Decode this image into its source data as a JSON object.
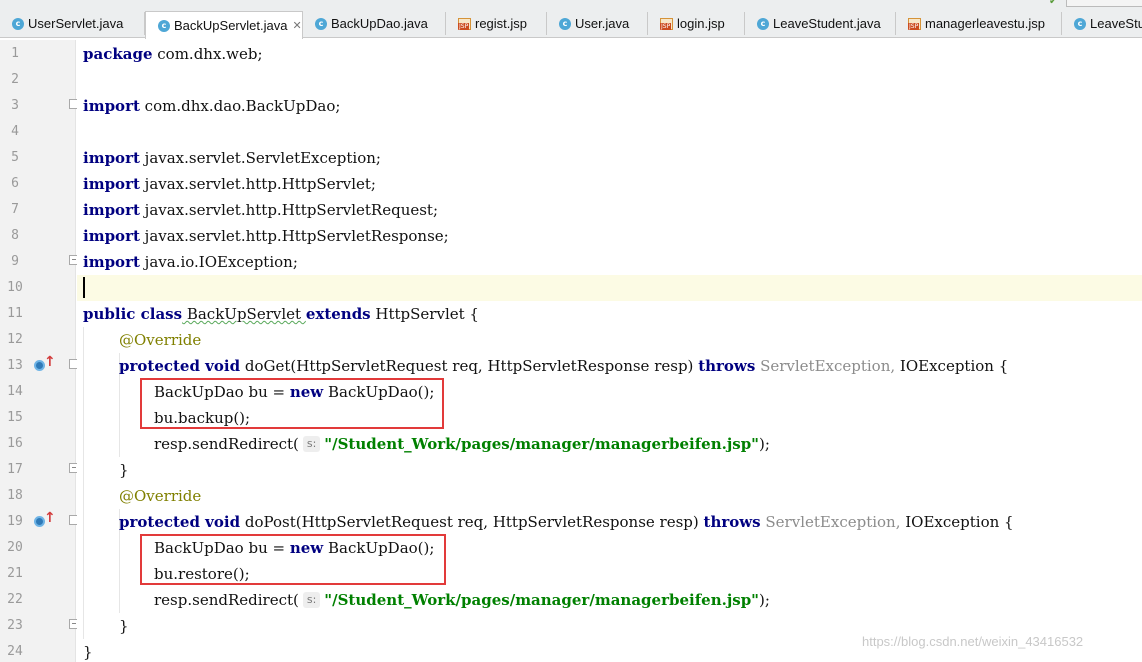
{
  "tabs": [
    {
      "name": "UserServlet.java",
      "type": "java",
      "active": false
    },
    {
      "name": "BackUpServlet.java",
      "type": "java",
      "active": true
    },
    {
      "name": "BackUpDao.java",
      "type": "java",
      "active": false
    },
    {
      "name": "regist.jsp",
      "type": "jsp",
      "active": false
    },
    {
      "name": "User.java",
      "type": "java",
      "active": false
    },
    {
      "name": "login.jsp",
      "type": "jsp",
      "active": false
    },
    {
      "name": "LeaveStudent.java",
      "type": "java",
      "active": false
    },
    {
      "name": "managerleavestu.jsp",
      "type": "jsp",
      "active": false
    },
    {
      "name": "LeaveStud",
      "type": "java",
      "active": false
    }
  ],
  "icons": {
    "java_file": "java-class-icon",
    "jsp_file": "jsp-file-icon",
    "close": "close-icon",
    "override": "override-method-icon"
  },
  "icon_glyphs": {
    "java": "c",
    "jsp": "JSP",
    "close": "✕",
    "arrow": "↑"
  },
  "line_numbers": [
    "1",
    "2",
    "3",
    "4",
    "5",
    "6",
    "7",
    "8",
    "9",
    "10",
    "11",
    "12",
    "13",
    "14",
    "15",
    "16",
    "17",
    "18",
    "19",
    "20",
    "21",
    "22",
    "23",
    "24"
  ],
  "code": {
    "l1": {
      "kw": "package",
      "rest": " com.dhx.web;"
    },
    "l3": {
      "kw": "import",
      "rest": " com.dhx.dao.BackUpDao;"
    },
    "l5": {
      "kw": "import",
      "rest": " javax.servlet.ServletException;"
    },
    "l6": {
      "kw": "import",
      "rest": " javax.servlet.http.HttpServlet;"
    },
    "l7": {
      "kw": "import",
      "rest": " javax.servlet.http.HttpServletRequest;"
    },
    "l8": {
      "kw": "import",
      "rest": " javax.servlet.http.HttpServletResponse;"
    },
    "l9": {
      "kw": "import",
      "rest": " java.io.IOException;"
    },
    "l11": {
      "kw1": "public class",
      "name": " BackUpServlet ",
      "kw2": "extends",
      "rest": " HttpServlet {"
    },
    "l12": {
      "ann": "@Override"
    },
    "l13": {
      "kw1": "protected void",
      "sig": " doGet(HttpServletRequest req, HttpServletResponse resp) ",
      "kw2": "throws",
      "exc1": " ServletException,",
      "exc2": " IOException {"
    },
    "l14": {
      "a": "BackUpDao bu = ",
      "kw": "new",
      "b": " BackUpDao();"
    },
    "l15": {
      "a": "bu.backup();"
    },
    "l16": {
      "a": "resp.sendRedirect(",
      "hint": "s:",
      "str": "\"/Student_Work/pages/manager/managerbeifen.jsp\"",
      "b": ");"
    },
    "l17": {
      "a": "}"
    },
    "l18": {
      "ann": "@Override"
    },
    "l19": {
      "kw1": "protected void",
      "sig": " doPost(HttpServletRequest req, HttpServletResponse resp) ",
      "kw2": "throws",
      "exc1": " ServletException,",
      "exc2": " IOException {"
    },
    "l20": {
      "a": "BackUpDao bu = ",
      "kw": "new",
      "b": " BackUpDao();"
    },
    "l21": {
      "a": "bu.restore();"
    },
    "l22": {
      "a": "resp.sendRedirect(",
      "hint": "s:",
      "str": "\"/Student_Work/pages/manager/managerbeifen.jsp\"",
      "b": ");"
    },
    "l23": {
      "a": "}"
    },
    "l24": {
      "a": "}"
    }
  },
  "watermark": "https://blog.csdn.net/weixin_43416532",
  "colors": {
    "keyword": "#000080",
    "annotation": "#808000",
    "string": "#008000",
    "highlight_box": "#e23a3a",
    "caret_line": "#fcfbe4"
  }
}
